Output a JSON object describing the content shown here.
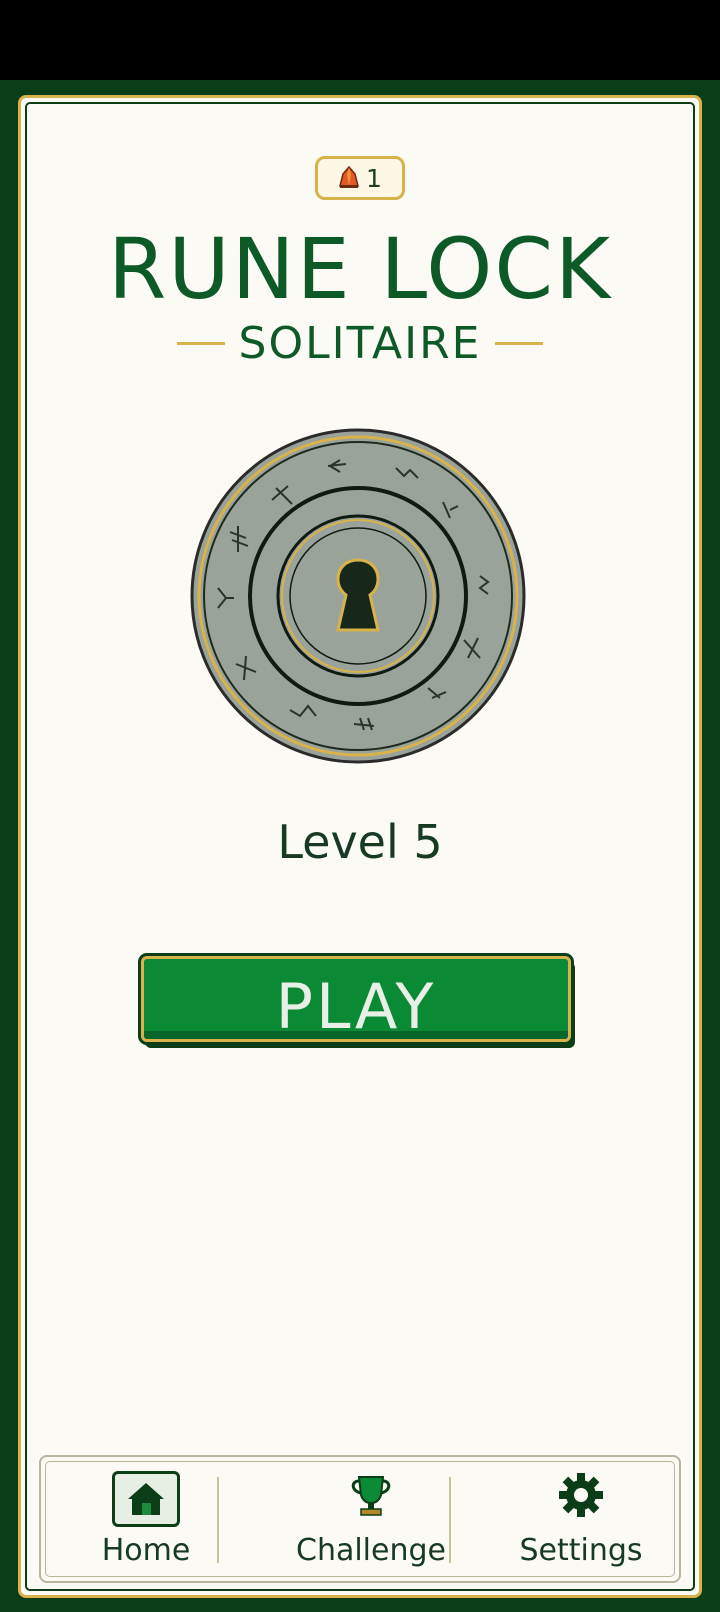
{
  "header": {
    "gem_count": "1",
    "title": "RUNE LOCK",
    "subtitle": "SOLITAIRE"
  },
  "main": {
    "level_label": "Level 5",
    "play_label": "PLAY"
  },
  "nav": {
    "home_label": "Home",
    "challenge_label": "Challenge",
    "settings_label": "Settings",
    "active": "Home"
  },
  "icons": {
    "gem": "gem-icon",
    "lock": "keyhole-icon",
    "home": "house-icon",
    "challenge": "trophy-icon",
    "settings": "gear-icon"
  },
  "colors": {
    "brand_green": "#0d5a26",
    "frame_green": "#0b3d16",
    "gold": "#d8b24a",
    "button_green": "#0b8a36",
    "background": "#fbfaf5"
  }
}
